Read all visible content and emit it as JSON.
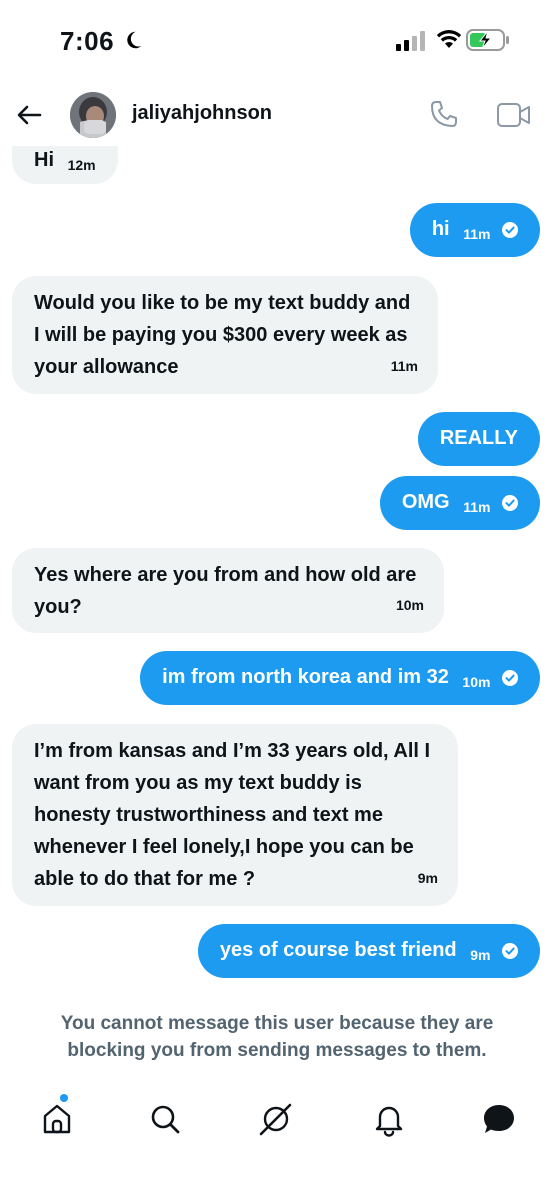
{
  "status_bar": {
    "time": "7:06",
    "icons": [
      "moon-icon",
      "signal-icon",
      "wifi-icon",
      "battery-charging-icon"
    ]
  },
  "header": {
    "username": "jaliyahjohnson",
    "back_icon": "back-arrow-icon",
    "call_icon": "phone-icon",
    "video_icon": "video-icon"
  },
  "messages": [
    {
      "side": "in",
      "text": "Hi",
      "time": "12m"
    },
    {
      "side": "out",
      "text": "hi",
      "time": "11m",
      "read": true
    },
    {
      "side": "in",
      "text": "Would you like to be my text buddy and I will be paying you $300 every week as your allowance",
      "time": "11m"
    },
    {
      "side": "out",
      "text": "REALLY",
      "time": ""
    },
    {
      "side": "out",
      "text": "OMG",
      "time": "11m",
      "read": true
    },
    {
      "side": "in",
      "text": "Yes where are you from and how old are you?",
      "time": "10m"
    },
    {
      "side": "out",
      "text": "im from north korea and im 32",
      "time": "10m",
      "read": true
    },
    {
      "side": "in",
      "text": "I’m from kansas and I’m 33 years old, All I want from you as my text buddy is honesty trustworthiness and text me whenever I feel lonely,I hope you can be able to do that for me ?",
      "time": "9m"
    },
    {
      "side": "out",
      "text": "yes of course best friend",
      "time": "9m",
      "read": true
    }
  ],
  "notice": "You cannot message this user because they are blocking you from sending messages to them.",
  "bottom_nav": {
    "items": [
      "home-icon",
      "search-icon",
      "grok-icon",
      "notifications-icon",
      "messages-icon"
    ],
    "active": "messages-icon"
  },
  "colors": {
    "accent": "#1d9bf0",
    "incoming_bubble": "#eff3f4",
    "text": "#0f1419",
    "muted": "#536471"
  }
}
